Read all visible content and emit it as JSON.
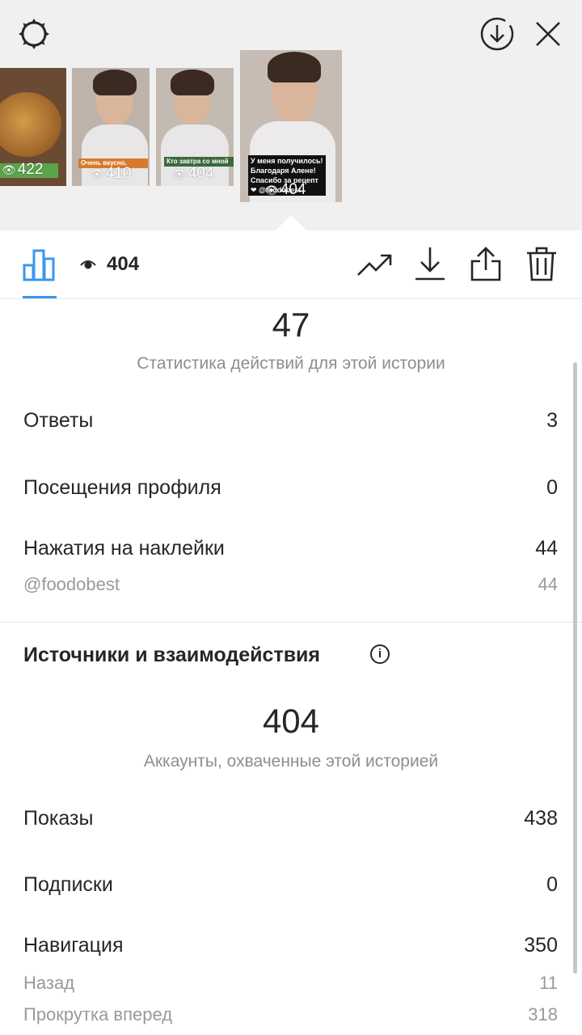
{
  "header": {
    "settings_icon": "gear-icon",
    "download_icon": "download-circle-icon",
    "close_icon": "close-icon"
  },
  "thumbnails": [
    {
      "views": "422",
      "caption": ""
    },
    {
      "views": "410",
      "caption": "Очень вкусно,"
    },
    {
      "views": "404",
      "caption": "Кто завтра со мной"
    },
    {
      "views": "404",
      "caption": "У меня получилось! Благодаря Алене! Спасибо за рецепт ❤ @foodobest"
    }
  ],
  "toolbar": {
    "views_count": "404",
    "icons": [
      "insights-bar-chart-icon",
      "trending-icon",
      "download-icon",
      "share-icon",
      "trash-icon"
    ]
  },
  "actions": {
    "total": "47",
    "caption": "Статистика действий для этой истории",
    "rows": [
      {
        "label": "Ответы",
        "value": "3"
      },
      {
        "label": "Посещения профиля",
        "value": "0"
      },
      {
        "label": "Нажатия на наклейки",
        "value": "44"
      }
    ],
    "sticker": {
      "label": "@foodobest",
      "value": "44"
    }
  },
  "discovery": {
    "title": "Источники и взаимодействия",
    "reach": "404",
    "reach_caption": "Аккаунты, охваченные этой историей",
    "rows": [
      {
        "label": "Показы",
        "value": "438"
      },
      {
        "label": "Подписки",
        "value": "0"
      },
      {
        "label": "Навигация",
        "value": "350"
      }
    ],
    "nav_rows": [
      {
        "label": "Назад",
        "value": "11"
      },
      {
        "label": "Прокрутка вперед",
        "value": "318"
      }
    ]
  },
  "colors": {
    "accent": "#3897f0",
    "text": "#262626",
    "muted": "#8e8e8e"
  }
}
